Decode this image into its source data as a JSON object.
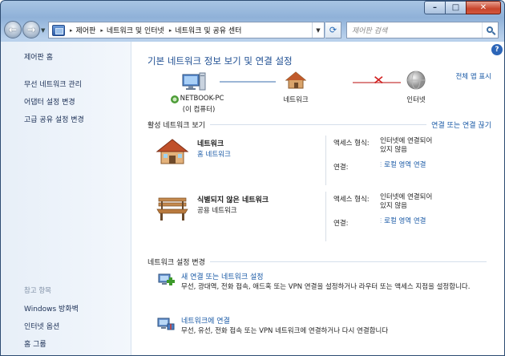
{
  "window": {
    "min_label": "–",
    "max_label": "□",
    "close_label": "✕"
  },
  "nav": {
    "back_icon": "←",
    "forward_icon": "→"
  },
  "address": {
    "crumbs": [
      "제어판",
      "네트워크 및 인터넷",
      "네트워크 및 공유 센터"
    ],
    "arrow": "▸"
  },
  "search": {
    "placeholder": "제어판 검색"
  },
  "left": {
    "home": "제어판 홈",
    "links": [
      "무선 네트워크 관리",
      "어댑터 설정 변경",
      "고급 공유 설정 변경"
    ],
    "see_also_title": "참고 항목",
    "see_also": [
      "Windows 방화벽",
      "인터넷 옵션",
      "홈 그룹"
    ]
  },
  "main": {
    "title": "기본 네트워크 정보 보기 및 연결 설정",
    "full_map": "전체 맵 표시",
    "nodes": {
      "computer_name": "NETBOOK-PC",
      "computer_sub": "(이 컴퓨터)",
      "network": "네트워크",
      "internet": "인터넷"
    },
    "active_section": {
      "title": "활성 네트워크 보기",
      "link": "연결 또는 연결 끊기"
    },
    "networks": [
      {
        "name": "네트워크",
        "type": "홈 네트워크",
        "access_label": "액세스 형식:",
        "access_value": "인터넷에 연결되어\n있지 않음",
        "conn_label": "연결:",
        "conn_value": "로컬 영역 연결"
      },
      {
        "name": "식별되지 않은 네트워크",
        "type": "공용 네트워크",
        "access_label": "액세스 형식:",
        "access_value": "인터넷에 연결되어\n있지 않음",
        "conn_label": "연결:",
        "conn_value": "로컬 영역 연결"
      }
    ],
    "change_section": {
      "title": "네트워크 설정 변경"
    },
    "tasks": [
      {
        "title": "새 연결 또는 네트워크 설정",
        "desc": "무선, 광대역, 전화 접속, 애드혹 또는 VPN 연결을 설정하거나 라우터 또는 액세스 지점을 설정합니다."
      },
      {
        "title": "네트워크에 연결",
        "desc": "무선, 유선, 전화 접속 또는 VPN 네트워크에 연결하거나 다시 연결합니다"
      }
    ]
  },
  "help": {
    "label": "?"
  }
}
